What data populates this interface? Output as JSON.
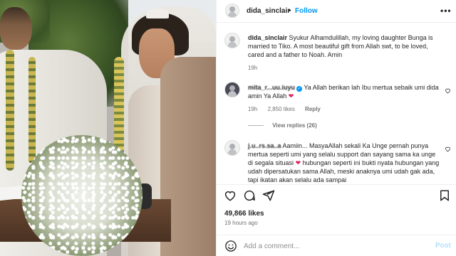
{
  "header": {
    "username": "dida_sinclair",
    "separator": "•",
    "follow_label": "Follow",
    "more_label": "•••"
  },
  "caption": {
    "username": "dida_sinclair",
    "text": "Syukur Alhamdulillah, my loving daughter Bunga is married to Tiko. A most beautiful gift from Allah swt, to be loved, cared and a father to Noah. Amin",
    "time": "19h"
  },
  "comments": [
    {
      "username": "mita_r...uu.iuyu",
      "verified": true,
      "text": "Ya Allah berikan lah Ibu mertua sebaik umi dida amin Ya Allah",
      "emoji": "❤",
      "time": "19h",
      "likes": "2,850 likes",
      "reply_label": "Reply",
      "view_replies": "View replies (26)"
    },
    {
      "username": "j.u..rs.sa..a",
      "text_1": "Aamiin... MasyaAllah sekali Ka Unge pernah punya mertua seperti umi yang selalu support dan sayang sama ka unge di segala situasi",
      "emoji": "❤",
      "text_2": "hubungan seperti ini bukti nyata hubungan yang udah dipersatukan sama Allah, meski anaknya umi udah gak ada, tapi ikatan akan selalu ada sampai"
    }
  ],
  "actions": {
    "like": "heart-icon",
    "comment": "comment-icon",
    "share": "share-icon",
    "save": "bookmark-icon"
  },
  "likes_text": "49,866 likes",
  "posted_time": "19 hours ago",
  "add_comment": {
    "placeholder": "Add a comment...",
    "post_label": "Post"
  },
  "colors": {
    "accent": "#0095f6",
    "heart": "#e0245e",
    "muted": "#737373"
  }
}
